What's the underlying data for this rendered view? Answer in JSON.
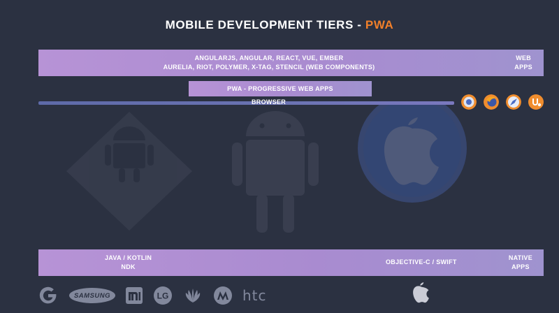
{
  "title": {
    "main": "MOBILE DEVELOPMENT TIERS - ",
    "accent": "PWA",
    "accent_color": "#f07f2a"
  },
  "web_tier": {
    "line1": "ANGULARJS, ANGULAR, REACT, VUE, EMBER",
    "line2": "AURELIA, RIOT, POLYMER, X-TAG, STENCIL (WEB COMPONENTS)",
    "side_line1": "WEB",
    "side_line2": "APPS"
  },
  "pwa_tier": {
    "label": "PWA - PROGRESSIVE WEB APPS"
  },
  "browser_tier": {
    "label": "BROWSER",
    "icons": [
      "chrome-icon",
      "firefox-icon",
      "safari-icon",
      "uc-browser-icon"
    ]
  },
  "native_tier": {
    "left_line1": "JAVA / KOTLIN",
    "left_line2": "NDK",
    "middle": "OBJECTIVE-C / SWIFT",
    "side_line1": "NATIVE",
    "side_line2": "APPS"
  },
  "background_art": [
    "android-diamond-icon",
    "android-robot-icon",
    "apple-circle-icon"
  ],
  "vendor_logos": {
    "samsung": "SAMSUNG",
    "htc": "htc",
    "icons": [
      "google-icon",
      "samsung-logo",
      "xiaomi-icon",
      "lg-icon",
      "huawei-icon",
      "motorola-icon",
      "htc-logo",
      "apple-icon"
    ]
  },
  "colors": {
    "background": "#2b3141",
    "bar_gradient_start": "#b793d6",
    "bar_gradient_end": "#9f93cf",
    "browser_line": "#6b73b3"
  }
}
